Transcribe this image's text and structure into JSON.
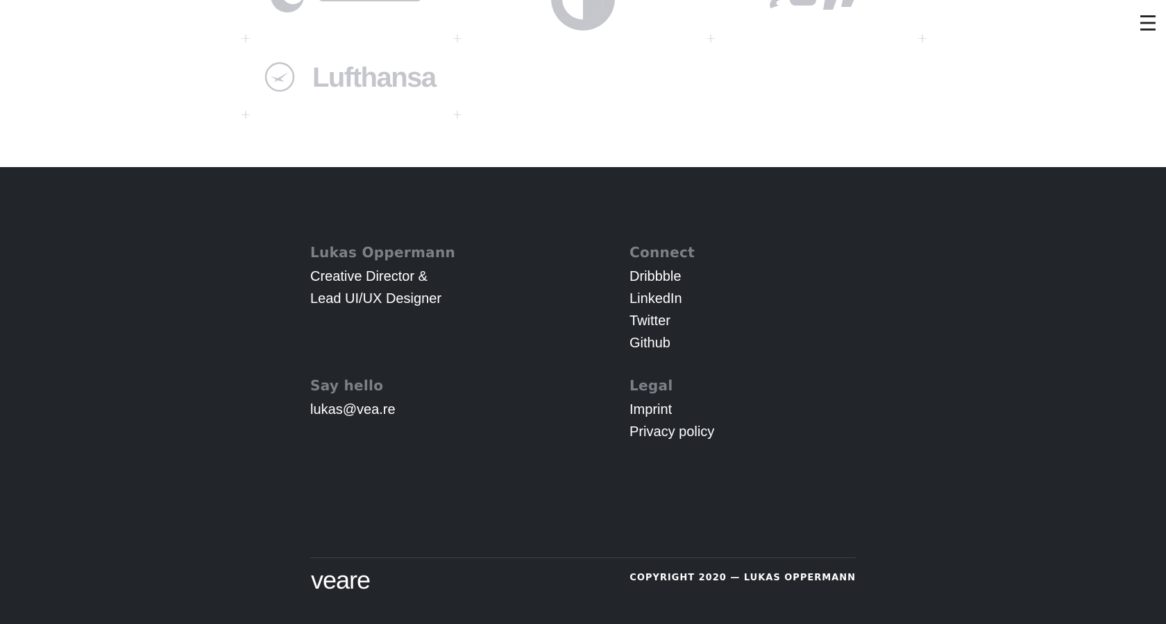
{
  "logos": {
    "lufthansa": "Lufthansa",
    "partial_logo_1": "",
    "partial_logo_2": "",
    "partial_logo_3": ""
  },
  "menu": {
    "icon": "hamburger-icon",
    "glyph": "☰"
  },
  "footer": {
    "about": {
      "heading": "Lukas Oppermann",
      "lines": [
        "Creative Director &",
        "Lead UI/UX Designer"
      ]
    },
    "connect": {
      "heading": "Connect",
      "links": [
        "Dribbble",
        "LinkedIn",
        "Twitter",
        "Github"
      ]
    },
    "say_hello": {
      "heading": "Say hello",
      "email": "lukas@vea.re"
    },
    "legal": {
      "heading": "Legal",
      "links": [
        "Imprint",
        "Privacy policy"
      ]
    },
    "brand": "veare",
    "copyright": "COPYRIGHT 2020 — LUKAS OPPERMANN"
  },
  "colors": {
    "footer_bg": "#22252a",
    "heading_gray": "#7d8087",
    "logo_gray": "#c4c6cc",
    "text_white": "#ffffff"
  }
}
